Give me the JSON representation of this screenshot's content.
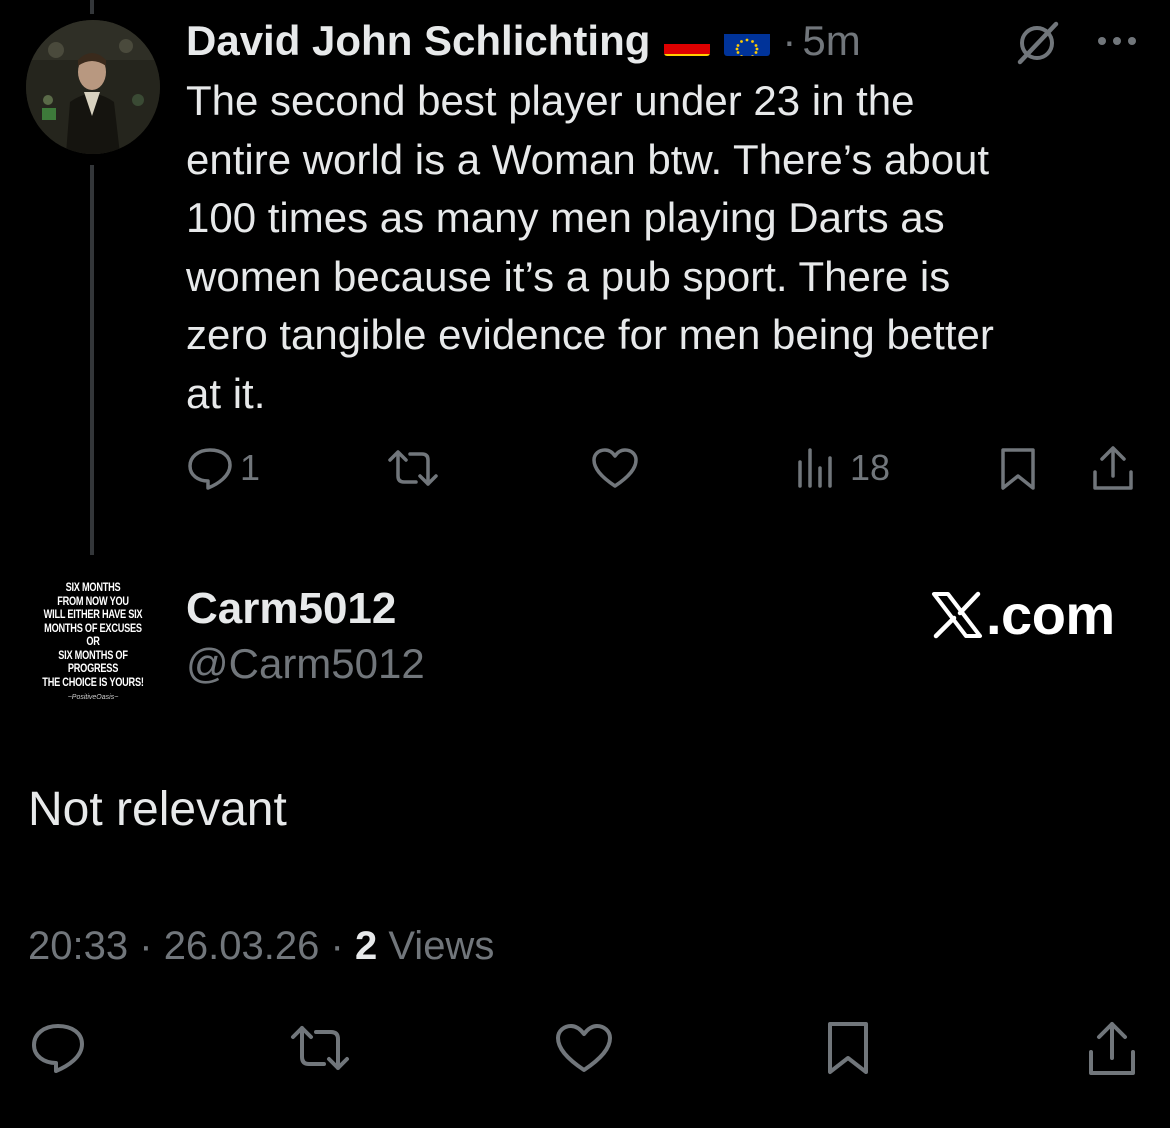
{
  "parent_post": {
    "author_name": "David John Schlichting",
    "flags": [
      "flag-germany-icon",
      "flag-eu-icon"
    ],
    "separator": "·",
    "time_ago": "5m",
    "text": "The second best player under 23 in the\nentire world is a Woman btw. There’s about\n100 times as many men playing Darts as\nwomen because it’s a pub sport. There is\nzero tangible evidence for men being better\nat it.",
    "reply_count": "1",
    "repost_count": "",
    "like_count": "",
    "view_count": "18"
  },
  "reply_post": {
    "avatar_text": "SIX MONTHS\nFROM NOW YOU\nWILL EITHER HAVE SIX\nMONTHS OF EXCUSES OR\nSIX MONTHS OF PROGRESS\nTHE CHOICE IS YOURS!",
    "avatar_signature": "~PositiveOasis~",
    "author_name": "Carm5012",
    "handle": "@Carm5012",
    "text": "Not relevant",
    "time": "20:33",
    "sep1": "·",
    "date": "26.03.26",
    "sep2": "·",
    "views": "2",
    "views_label": "Views"
  },
  "watermark": {
    "text": ".com"
  },
  "icons": {
    "grok": "grok-icon",
    "more": "more-icon",
    "reply": "reply-icon",
    "repost": "repost-icon",
    "like": "like-icon",
    "views": "views-icon",
    "bookmark": "bookmark-icon",
    "share": "share-icon"
  },
  "colors": {
    "background": "#000000",
    "text_primary": "#e7e9ea",
    "text_secondary": "#71767b",
    "thread_line": "#333639"
  }
}
